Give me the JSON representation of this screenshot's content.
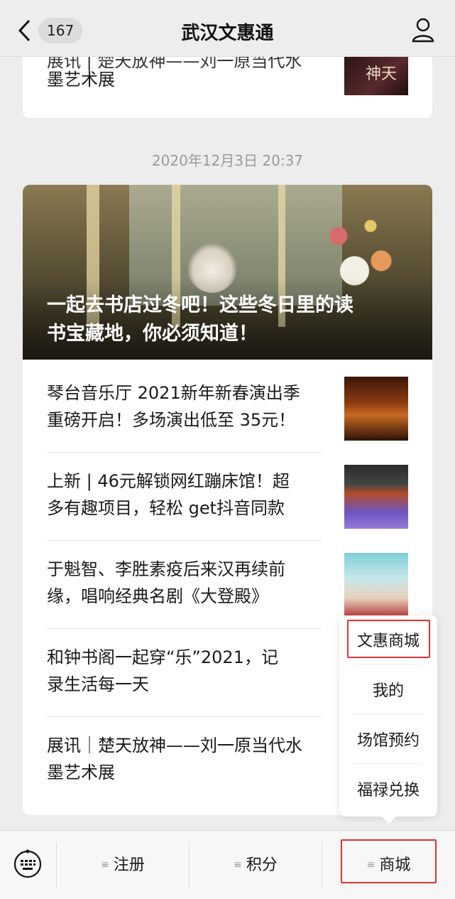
{
  "header": {
    "unread_count": "167",
    "title": "武汉文惠通"
  },
  "previous_card": {
    "partial_line": "展讯 | 楚天放神——刘一原当代水",
    "title_tail": "墨艺术展",
    "thumb_glyph": "神天"
  },
  "timestamp": "2020年12月3日 20:37",
  "hero": {
    "title_line1": "一起去书店过冬吧！这些冬日里的读",
    "title_line2": "书宝藏地，你必须知道！"
  },
  "articles": [
    {
      "line1": "琴台音乐厅 2021新年新春演出季",
      "line2": "重磅开启！多场演出低至 35元！",
      "thumb": "concert-hall-image"
    },
    {
      "line1": "上新 | 46元解锁网红蹦床馆！超",
      "line2": "多有趣项目，轻松 get抖音同款",
      "thumb": "trampoline-park-image"
    },
    {
      "line1": "于魁智、李胜素疫后来汉再续前",
      "line2": "缘，唱响经典名剧《大登殿》",
      "thumb": "peking-opera-image"
    },
    {
      "line1": "和钟书阁一起穿“乐”2021，记",
      "line2": "录生活每一天"
    },
    {
      "line1": "展讯｜楚天放神——刘一原当代水",
      "line2": "墨艺术展"
    }
  ],
  "popup_menu": {
    "items": [
      "文惠商城",
      "我的",
      "场馆预约",
      "福禄兑换"
    ]
  },
  "bottom_bar": {
    "items": [
      "注册",
      "积分",
      "商城"
    ]
  },
  "colors": {
    "highlight_border": "#e03232",
    "background": "#ededed"
  }
}
